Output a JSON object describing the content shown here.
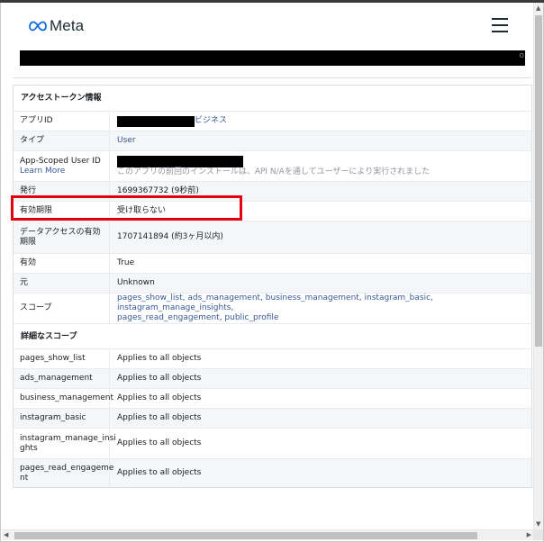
{
  "header": {
    "logo_text": "Meta",
    "brand_color": "#0668E1"
  },
  "token_bar": {
    "end_char": "o"
  },
  "access_token_section": {
    "title": "アクセストークン情報",
    "app_id_label": "アプリID",
    "app_id_value_suffix": "ビジネス",
    "type_label": "タイプ",
    "type_value": "User",
    "user_id_label": "App-Scoped User ID",
    "learn_more": "Learn More",
    "user_id_note": "このアプリの前回のインストールは、API N/Aを通してユーザーにより実行されました",
    "issued_label": "発行",
    "issued_value": "1699367732 (9秒前)",
    "expires_label": "有効期限",
    "expires_value": "受け取らない",
    "data_access_label_line1": "データアクセスの有効",
    "data_access_label_line2": "期限",
    "data_access_value": "1707141894 (約3ヶ月以内)",
    "valid_label": "有効",
    "valid_value": "True",
    "origin_label": "元",
    "origin_value": "Unknown",
    "scopes_label": "スコープ",
    "scopes_line1": "pages_show_list, ads_management, business_management, instagram_basic, instagram_manage_insights,",
    "scopes_line2": "pages_read_engagement, public_profile"
  },
  "granular_section": {
    "title": "詳細なスコープ",
    "rows": [
      {
        "key_line1": "pages_show_list",
        "key_line2": "",
        "value": "Applies to all objects"
      },
      {
        "key_line1": "ads_management",
        "key_line2": "",
        "value": "Applies to all objects"
      },
      {
        "key_line1": "business_management",
        "key_line2": "",
        "value": "Applies to all objects"
      },
      {
        "key_line1": "instagram_basic",
        "key_line2": "",
        "value": "Applies to all objects"
      },
      {
        "key_line1": "instagram_manage_insi",
        "key_line2": "ghts",
        "value": "Applies to all objects"
      },
      {
        "key_line1": "pages_read_engageme",
        "key_line2": "nt",
        "value": "Applies to all objects"
      }
    ]
  }
}
